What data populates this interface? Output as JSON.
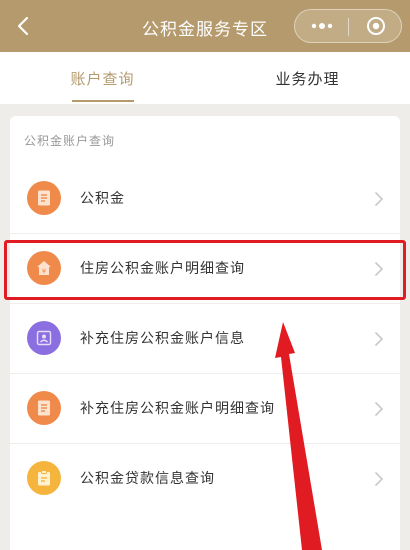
{
  "header": {
    "title": "公积金服务专区",
    "back_icon": "chevron-left-icon",
    "more_icon": "more-dots-icon",
    "close_icon": "target-close-icon",
    "bg_color": "#b49a6c"
  },
  "tabs": [
    {
      "label": "账户查询",
      "active": true
    },
    {
      "label": "业务办理",
      "active": false
    }
  ],
  "section": {
    "title": "公积金账户查询",
    "items": [
      {
        "label": "公积金",
        "icon": "document-icon",
        "icon_color": "#f08a4b"
      },
      {
        "label": "住房公积金账户明细查询",
        "icon": "house-yuan-icon",
        "icon_color": "#f08a4b",
        "highlighted": true
      },
      {
        "label": "补充住房公积金账户信息",
        "icon": "account-info-icon",
        "icon_color": "#8b6fe0"
      },
      {
        "label": "补充住房公积金账户明细查询",
        "icon": "document-icon",
        "icon_color": "#f08a4b"
      },
      {
        "label": "公积金贷款信息查询",
        "icon": "clipboard-icon",
        "icon_color": "#f5b53d"
      }
    ]
  },
  "annotation": {
    "highlight_color": "#e11b22"
  }
}
